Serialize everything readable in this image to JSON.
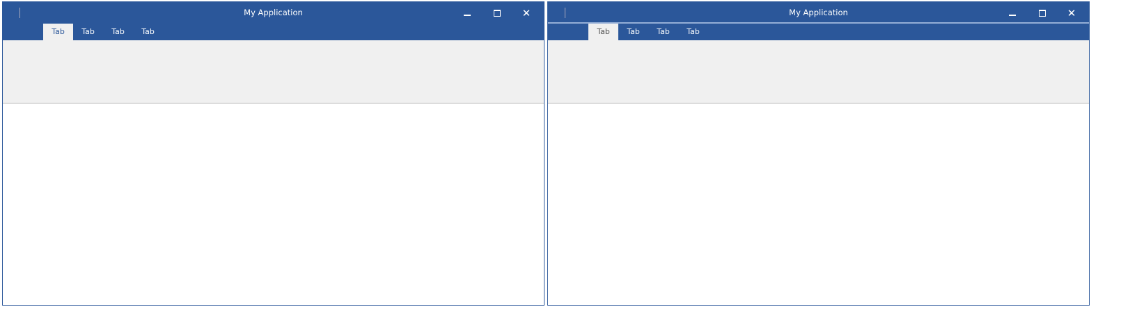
{
  "windows": [
    {
      "title": "My Application",
      "tabs": [
        "Tab",
        "Tab",
        "Tab",
        "Tab"
      ],
      "active_tab": 0
    },
    {
      "title": "My Application",
      "tabs": [
        "Tab",
        "Tab",
        "Tab",
        "Tab"
      ],
      "active_tab": 0
    }
  ],
  "colors": {
    "titlebar": "#2b579a",
    "ribbon": "#f0f0f0"
  }
}
